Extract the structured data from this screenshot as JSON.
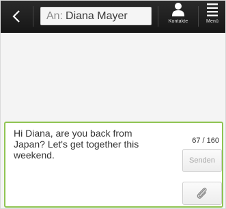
{
  "header": {
    "recipient_prefix": "An:",
    "recipient_name": "Diana Mayer",
    "contacts_label": "Kontakte",
    "menu_label": "Menü"
  },
  "composer": {
    "message": "Hi Diana, are you back from Japan? Let's get together this weekend.",
    "char_count": "67 / 160",
    "send_label": "Senden"
  },
  "icons": {
    "back": "back-arrow-icon",
    "contacts": "person-icon",
    "menu": "menu-icon",
    "attach": "paperclip-icon"
  },
  "colors": {
    "accent": "#8fc452",
    "topbar": "#1c1c1c"
  }
}
